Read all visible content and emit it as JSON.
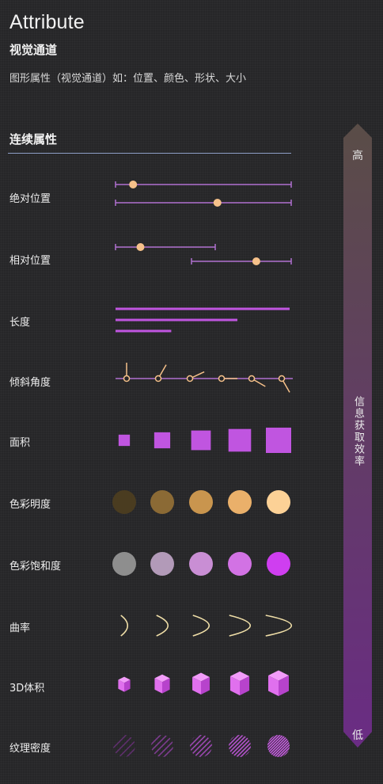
{
  "header": {
    "title": "Attribute",
    "subtitle": "视觉通道",
    "description": "图形属性（视觉通道）如：位置、颜色、形状、大小"
  },
  "section": {
    "title": "连续属性"
  },
  "rows": [
    {
      "label": "绝对位置",
      "kind": "abs-position",
      "values": [
        0.1,
        0.58
      ]
    },
    {
      "label": "相对位置",
      "kind": "rel-position",
      "values": [
        0.25,
        0.65
      ]
    },
    {
      "label": "长度",
      "kind": "length",
      "values": [
        1.0,
        0.7,
        0.32
      ]
    },
    {
      "label": "倾斜角度",
      "kind": "angle",
      "values": [
        90,
        60,
        25,
        0,
        -30,
        -60
      ]
    },
    {
      "label": "面积",
      "kind": "area",
      "values": [
        1,
        2,
        3,
        4,
        5
      ]
    },
    {
      "label": "色彩明度",
      "kind": "lightness",
      "colors": [
        "#4a3c20",
        "#8b6a35",
        "#c9954e",
        "#eab06a",
        "#fcd196"
      ]
    },
    {
      "label": "色彩饱和度",
      "kind": "saturation",
      "colors": [
        "#8e8e8e",
        "#b29ab8",
        "#c98ed4",
        "#d272e4",
        "#cf3ef0"
      ]
    },
    {
      "label": "曲率",
      "kind": "curvature",
      "values": [
        0.15,
        0.35,
        0.55,
        0.75,
        0.95
      ]
    },
    {
      "label": "3D体积",
      "kind": "volume",
      "values": [
        1,
        2,
        3,
        4,
        5
      ]
    },
    {
      "label": "纹理密度",
      "kind": "texture",
      "values": [
        1,
        2,
        3,
        4,
        5
      ]
    }
  ],
  "arrow": {
    "top_label": "高",
    "bottom_label": "低",
    "text": "信息获取效率",
    "color_top": "#5a4d47",
    "color_bottom": "#6a2c84"
  },
  "colors": {
    "accent": "#c055e0",
    "dot": "#f6c18a",
    "line": "#b070d0"
  }
}
